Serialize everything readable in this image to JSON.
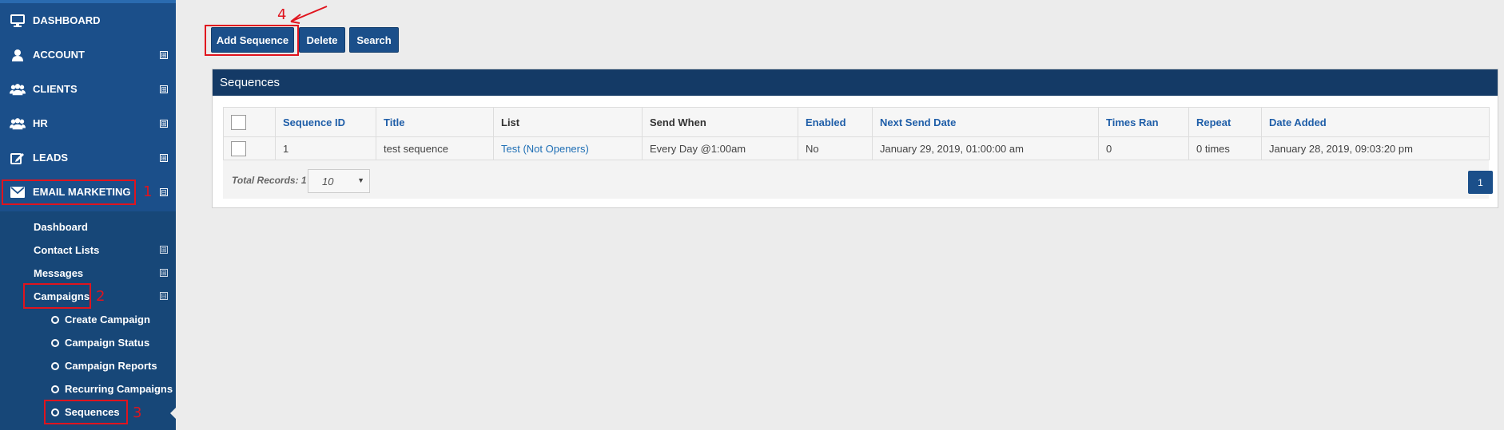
{
  "sidebar": {
    "items": [
      {
        "label": "DASHBOARD",
        "icon": "monitor-icon",
        "toggle": ""
      },
      {
        "label": "ACCOUNT",
        "icon": "user-icon",
        "toggle": "⊞"
      },
      {
        "label": "CLIENTS",
        "icon": "users-icon",
        "toggle": "⊞"
      },
      {
        "label": "HR",
        "icon": "users-icon",
        "toggle": "⊞"
      },
      {
        "label": "LEADS",
        "icon": "edit-icon",
        "toggle": "⊞"
      },
      {
        "label": "EMAIL MARKETING",
        "icon": "envelope-icon",
        "toggle": "⊟"
      }
    ],
    "email_marketing": {
      "items": [
        {
          "label": "Dashboard",
          "toggle": ""
        },
        {
          "label": "Contact Lists",
          "toggle": "⊞"
        },
        {
          "label": "Messages",
          "toggle": "⊞"
        },
        {
          "label": "Campaigns",
          "toggle": "⊟"
        }
      ],
      "campaigns": [
        {
          "label": "Create Campaign"
        },
        {
          "label": "Campaign Status"
        },
        {
          "label": "Campaign Reports"
        },
        {
          "label": "Recurring Campaigns"
        },
        {
          "label": "Sequences"
        }
      ]
    }
  },
  "annotations": [
    "1",
    "2",
    "3",
    "4"
  ],
  "toolbar": {
    "add_label": "Add Sequence",
    "delete_label": "Delete",
    "search_label": "Search"
  },
  "panel": {
    "title": "Sequences",
    "columns": [
      "Sequence ID",
      "Title",
      "List",
      "Send When",
      "Enabled",
      "Next Send Date",
      "Times Ran",
      "Repeat",
      "Date Added"
    ],
    "rows": [
      [
        "1",
        "test sequence",
        "Test (Not Openers)",
        "Every Day @1:00am",
        "No",
        "January 29, 2019, 01:00:00 am",
        "0",
        "0 times",
        "January 28, 2019, 09:03:20 pm"
      ]
    ],
    "total_records_label": "Total Records: 1",
    "page_size": "10",
    "page_caret": "▼",
    "current_page": "1"
  },
  "colors": {
    "sidebar": "#1b4f8a",
    "panel_header": "#143a66",
    "annotation": "#e0141e",
    "link": "#1f5ea8"
  }
}
